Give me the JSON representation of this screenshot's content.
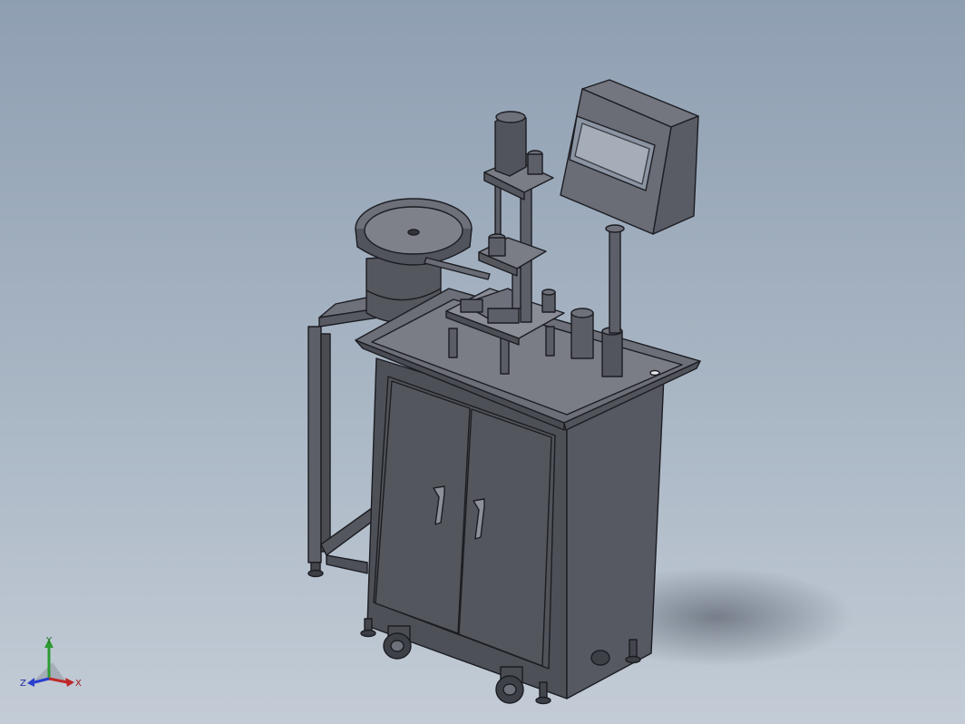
{
  "axes": {
    "x": "X",
    "y": "Y",
    "z": "Z"
  },
  "colors": {
    "background_top": "#8f9fb2",
    "background_bottom": "#c3ccd6",
    "body": "#5b5d66",
    "edge": "#1c1d22",
    "x_axis": "#c0282a",
    "y_axis": "#2e9a35",
    "z_axis": "#2a3ed0"
  }
}
